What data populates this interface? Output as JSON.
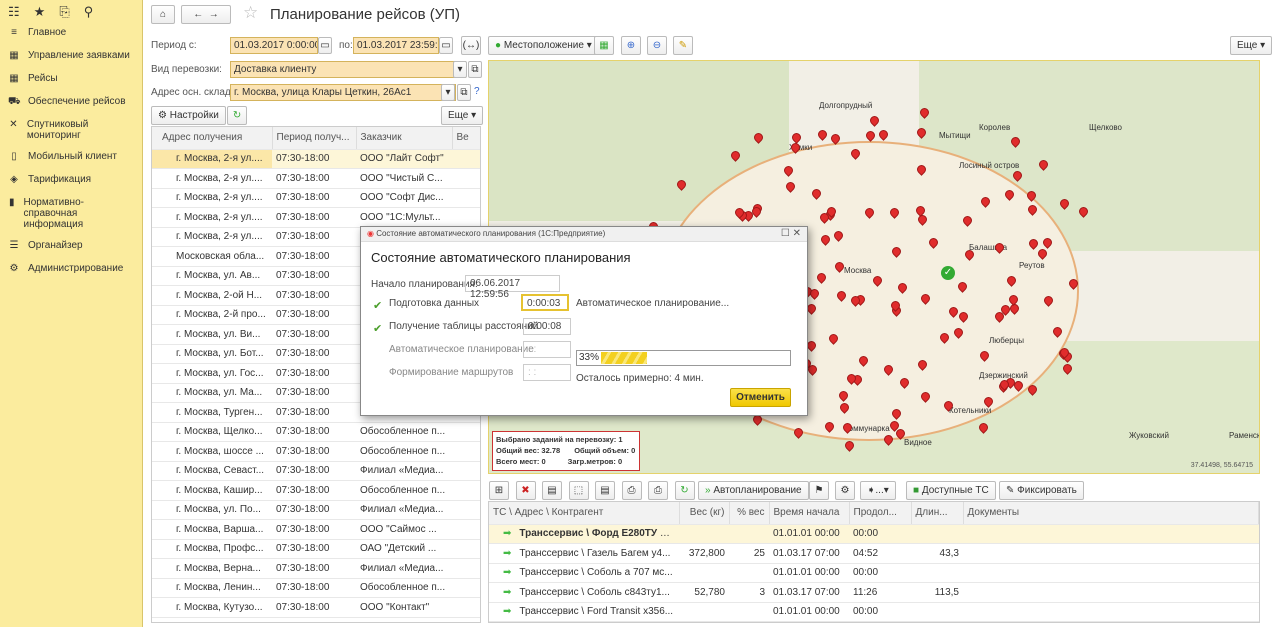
{
  "sidebar": {
    "top_icons": [
      "apps-icon",
      "star-icon",
      "history-icon",
      "search-icon"
    ],
    "items": [
      {
        "label": "Главное",
        "icon": "menu-icon"
      },
      {
        "label": "Управление заявками",
        "icon": "grid-icon"
      },
      {
        "label": "Рейсы",
        "icon": "calendar-icon"
      },
      {
        "label": "Обеспечение рейсов",
        "icon": "truck-icon"
      },
      {
        "label": "Спутниковый мониторинг",
        "icon": "satellite-icon"
      },
      {
        "label": "Мобильный клиент",
        "icon": "phone-icon"
      },
      {
        "label": "Тарификация",
        "icon": "tariff-icon"
      },
      {
        "label": "Нормативно-справочная информация",
        "icon": "book-icon"
      },
      {
        "label": "Органайзер",
        "icon": "organizer-icon"
      },
      {
        "label": "Администрирование",
        "icon": "gear-icon"
      }
    ]
  },
  "header": {
    "title": "Планирование рейсов (УП)"
  },
  "filters": {
    "period_from_label": "Период с:",
    "period_from": "01.03.2017  0:00:00",
    "period_to_label": "по:",
    "period_to": "01.03.2017 23:59:59",
    "transport_label": "Вид перевозки:",
    "transport": "Доставка клиенту",
    "warehouse_label": "Адрес осн. склада:",
    "warehouse": "г. Москва, улица Клары Цеткин, 26Ас1",
    "help": "?"
  },
  "left_toolbar": {
    "settings": "Настройки",
    "more": "Еще"
  },
  "left_table": {
    "columns": [
      "Адрес получения",
      "Период получ...",
      "Заказчик",
      "Ве"
    ],
    "rows": [
      [
        "г. Москва, 2-я ул....",
        "07:30-18:00",
        "ООО \"Лайт Софт\""
      ],
      [
        "г. Москва, 2-я ул....",
        "07:30-18:00",
        "ООО \"Чистый С..."
      ],
      [
        "г. Москва, 2-я ул....",
        "07:30-18:00",
        "ООО \"Софт Дис..."
      ],
      [
        "г. Москва, 2-я ул....",
        "07:30-18:00",
        "ООО \"1С:Мульт..."
      ],
      [
        "г. Москва, 2-я ул....",
        "07:30-18:00",
        ""
      ],
      [
        "Московская обла...",
        "07:30-18:00",
        ""
      ],
      [
        "г. Москва, ул. Ав...",
        "07:30-18:00",
        ""
      ],
      [
        "г. Москва, 2-ой Н...",
        "07:30-18:00",
        ""
      ],
      [
        "г. Москва, 2-й про...",
        "07:30-18:00",
        ""
      ],
      [
        "г. Москва, ул. Ви...",
        "07:30-18:00",
        ""
      ],
      [
        "г. Москва, ул. Бот...",
        "07:30-18:00",
        ""
      ],
      [
        "г. Москва, ул. Гос...",
        "07:30-18:00",
        ""
      ],
      [
        "г. Москва, ул. Ма...",
        "07:30-18:00",
        ""
      ],
      [
        "г. Москва, Турген...",
        "07:30-18:00",
        ""
      ],
      [
        "г. Москва, Щелко...",
        "07:30-18:00",
        "Обособленное п..."
      ],
      [
        "г. Москва, шоссе ...",
        "07:30-18:00",
        "Обособленное п..."
      ],
      [
        "г. Москва, Севаст...",
        "07:30-18:00",
        "Филиал «Медиа..."
      ],
      [
        "г. Москва, Кашир...",
        "07:30-18:00",
        "Обособленное п..."
      ],
      [
        "г. Москва, ул. По...",
        "07:30-18:00",
        "Филиал «Медиа..."
      ],
      [
        "г. Москва, Варша...",
        "07:30-18:00",
        "ООО \"Саймос ..."
      ],
      [
        "г. Москва, Профс...",
        "07:30-18:00",
        "ОАО \"Детский ..."
      ],
      [
        "г. Москва, Верна...",
        "07:30-18:00",
        "Филиал «Медиа..."
      ],
      [
        "г. Москва, Ленин...",
        "07:30-18:00",
        "Обособленное п..."
      ],
      [
        "г. Москва, Кутузо...",
        "07:30-18:00",
        "ООО \"Контакт\""
      ]
    ]
  },
  "map_toolbar": {
    "location": "Местоположение",
    "more": "Еще"
  },
  "map": {
    "labels": [
      "Долгопрудный",
      "Мытищи",
      "Королев",
      "Щелково",
      "Химки",
      "Красногорск",
      "Москва",
      "Балашиха",
      "Люберцы",
      "Реутов",
      "Видное",
      "Коммунарка",
      "Раменское",
      "Жуковский",
      "Дзержинский",
      "Котельники",
      "Лосиный остров"
    ],
    "coords": "37.41498, 55.64715",
    "summary": {
      "selected": "Выбрано заданий на перевозку: 1",
      "weight": "Общий вес: 32.78",
      "volume": "Общий объем: 0",
      "places": "Всего мест: 0",
      "meters": "Загр.метров: 0"
    }
  },
  "bottom_toolbar": {
    "autoplan": "Автопланирование",
    "available": "Доступные ТС",
    "fix": "Фиксировать",
    "dots": "..."
  },
  "bottom_table": {
    "columns": [
      "ТС \\ Адрес \\ Контрагент",
      "Вес (кг)",
      "% вес",
      "Время начала",
      "Продол...",
      "Длин...",
      "Документы"
    ],
    "rows": [
      [
        "Транссервис \\ Форд Е280ТУ Ро...",
        "",
        "",
        "01.01.01 00:00",
        "00:00",
        ""
      ],
      [
        "Транссервис \\ Газель Багем у4...",
        "372,800",
        "25",
        "01.03.17 07:00",
        "04:52",
        "43,3"
      ],
      [
        "Транссервис \\ Соболь а 707 мс...",
        "",
        "",
        "01.01.01 00:00",
        "00:00",
        ""
      ],
      [
        "Транссервис \\ Соболь с843ту1...",
        "52,780",
        "3",
        "01.03.17 07:00",
        "11:26",
        "113,5"
      ],
      [
        "Транссервис \\ Ford Transit х356...",
        "",
        "",
        "01.01.01 00:00",
        "00:00",
        ""
      ]
    ]
  },
  "dialog": {
    "window_title": "Состояние автоматического планирования  (1С:Предприятие)",
    "title": "Состояние автоматического планирования",
    "start_label": "Начало планирования:",
    "start": "06.06.2017 12:59:56",
    "steps": [
      {
        "label": "Подготовка данных",
        "time": "0:00:03",
        "done": true
      },
      {
        "label": "Получение таблицы расстояний",
        "time": "0:00:08",
        "done": true
      },
      {
        "label": "Автоматическое планирование",
        "time": " :  : ",
        "done": false
      },
      {
        "label": "Формирование маршрутов",
        "time": " :  : ",
        "done": false
      }
    ],
    "status": "Автоматическое планирование...",
    "progress_percent": 33,
    "progress_label": "33%",
    "remaining": "Осталось примерно: 4 мин.",
    "cancel": "Отменить"
  },
  "colors": {
    "accent": "#fbec9e",
    "pin": "#e02c2c",
    "button_yellow": "#f5d20c"
  }
}
